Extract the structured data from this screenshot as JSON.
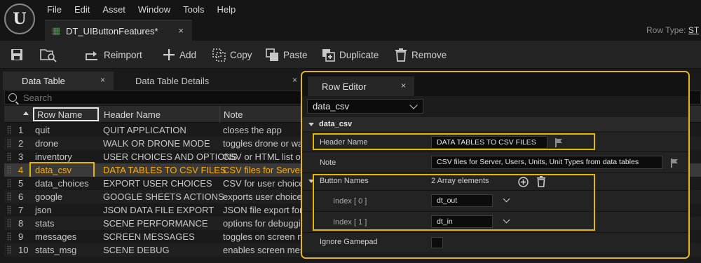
{
  "menu": [
    "File",
    "Edit",
    "Asset",
    "Window",
    "Tools",
    "Help"
  ],
  "document_tab": {
    "label": "DT_UIButtonFeatures*",
    "close": "×"
  },
  "row_type": {
    "label": "Row Type: ",
    "value": "ST"
  },
  "toolbar": {
    "reimport": "Reimport",
    "add": "Add",
    "copy": "Copy",
    "paste": "Paste",
    "duplicate": "Duplicate",
    "remove": "Remove"
  },
  "left_tabs": [
    {
      "label": "Data Table",
      "close": "×"
    },
    {
      "label": "Data Table Details",
      "close": "×"
    }
  ],
  "search": {
    "placeholder": "Search"
  },
  "columns": {
    "row_name": "Row Name",
    "header_name": "Header Name",
    "note": "Note"
  },
  "rows": [
    {
      "index": "1",
      "row_name": "quit",
      "header_name": "QUIT APPLICATION",
      "note": "closes the app"
    },
    {
      "index": "2",
      "row_name": "drone",
      "header_name": "WALK OR DRONE MODE",
      "note": "toggles drone or walk"
    },
    {
      "index": "3",
      "row_name": "inventory",
      "header_name": "USER CHOICES AND OPTIONS",
      "note": "CSV or HTML list of"
    },
    {
      "index": "4",
      "row_name": "data_csv",
      "header_name": "DATA TABLES TO CSV FILES",
      "note": "CSV files for Server, U"
    },
    {
      "index": "5",
      "row_name": "data_choices",
      "header_name": "EXPORT USER CHOICES",
      "note": "CSV for user choices"
    },
    {
      "index": "6",
      "row_name": "google",
      "header_name": "GOOGLE SHEETS ACTIONS",
      "note": "exports user choices"
    },
    {
      "index": "7",
      "row_name": "json",
      "header_name": "JSON DATA FILE EXPORT",
      "note": "JSON file export for u"
    },
    {
      "index": "8",
      "row_name": "stats",
      "header_name": "SCENE PERFORMANCE",
      "note": "options for debugging"
    },
    {
      "index": "9",
      "row_name": "messages",
      "header_name": "SCREEN MESSAGES",
      "note": "toggles on screen mes"
    },
    {
      "index": "10",
      "row_name": "stats_msg",
      "header_name": "SCENE DEBUG",
      "note": "enables screen mess"
    }
  ],
  "selected_row_index": 3,
  "row_editor": {
    "tab_label": "Row Editor",
    "tab_close": "×",
    "row_select": "data_csv",
    "section": "data_csv",
    "header_name": {
      "label": "Header Name",
      "value": "DATA TABLES TO CSV FILES"
    },
    "note": {
      "label": "Note",
      "value": "CSV files for Server, Users, Units, Unit Types from data tables"
    },
    "button_names": {
      "label": "Button Names",
      "count": "2 Array elements",
      "items": [
        {
          "label": "Index [ 0 ]",
          "value": "dt_out"
        },
        {
          "label": "Index [ 1 ]",
          "value": "dt_in"
        }
      ]
    },
    "ignore_gamepad": {
      "label": "Ignore Gamepad",
      "checked": false
    }
  },
  "colors": {
    "highlight": "#e8b400",
    "selected_text": "#ffae00"
  }
}
